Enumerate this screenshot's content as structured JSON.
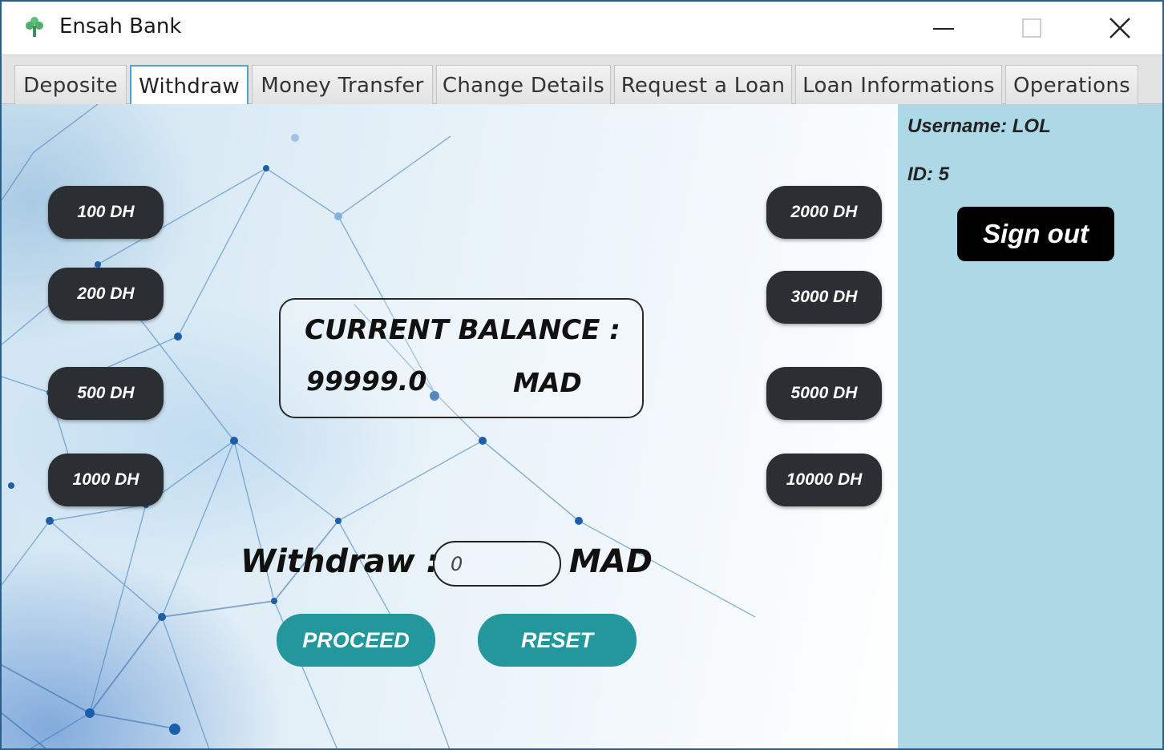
{
  "window": {
    "title": "Ensah Bank",
    "icon": "leaf-app-icon",
    "controls": [
      "minimize-icon",
      "maximize-icon",
      "close-icon"
    ]
  },
  "tabs": [
    {
      "label": "Deposite",
      "active": false
    },
    {
      "label": "Withdraw",
      "active": true
    },
    {
      "label": "Money Transfer",
      "active": false
    },
    {
      "label": "Change Details",
      "active": false
    },
    {
      "label": "Request a Loan",
      "active": false
    },
    {
      "label": "Loan Informations",
      "active": false
    },
    {
      "label": "Operations",
      "active": false
    }
  ],
  "amounts": {
    "left": [
      "100 DH",
      "200 DH",
      "500 DH",
      "1000 DH"
    ],
    "right": [
      "2000 DH",
      "3000 DH",
      "5000 DH",
      "10000 DH"
    ]
  },
  "balance": {
    "title": "CURRENT BALANCE :",
    "value": "99999.0",
    "currency": "MAD"
  },
  "withdraw": {
    "label": "Withdraw :",
    "placeholder": "0",
    "value": "",
    "currency": "MAD"
  },
  "actions": {
    "proceed": "PROCEED",
    "reset": "RESET"
  },
  "user": {
    "username_label": "Username:",
    "username": "LOL",
    "id_label": "ID:",
    "id": "5",
    "signout": "Sign out"
  },
  "colors": {
    "amount_button": "#2b2f33",
    "action_button": "#23979c",
    "side_panel": "#add8e6",
    "signout_button": "#000000",
    "active_tab_border": "#4fa3d9"
  }
}
